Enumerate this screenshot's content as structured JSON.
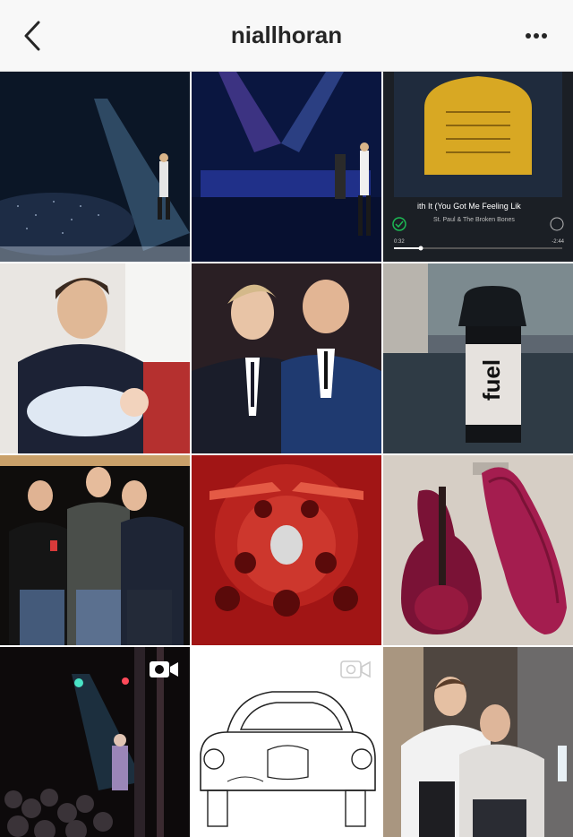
{
  "header": {
    "title": "niallhoran",
    "back_icon": "chevron-left-icon",
    "more_icon": "more-dots-icon"
  },
  "grid": {
    "tiles": [
      {
        "subject": "concert stage spotlight"
      },
      {
        "subject": "arena stage blue lights"
      },
      {
        "subject": "spotify now playing",
        "song": "ith It (You Got Me Feeling Lik",
        "artist": "St. Paul & The Broken Bones",
        "elapsed": "0:32",
        "remaining": "-2:44"
      },
      {
        "subject": "holding baby"
      },
      {
        "subject": "two men in suits"
      },
      {
        "subject": "fuel bottle on bed",
        "bottle_text": "fuel"
      },
      {
        "subject": "three men posing"
      },
      {
        "subject": "red football poster"
      },
      {
        "subject": "red guitar and case"
      },
      {
        "subject": "small club concert",
        "video_icon": "video-camera-icon"
      },
      {
        "subject": "car line drawing",
        "video_icon": "video-camera-icon"
      },
      {
        "subject": "two friends hugging"
      }
    ]
  },
  "colors": {
    "header_bg": "#f8f8f8",
    "text": "#262626",
    "spotify_green": "#1db954"
  }
}
